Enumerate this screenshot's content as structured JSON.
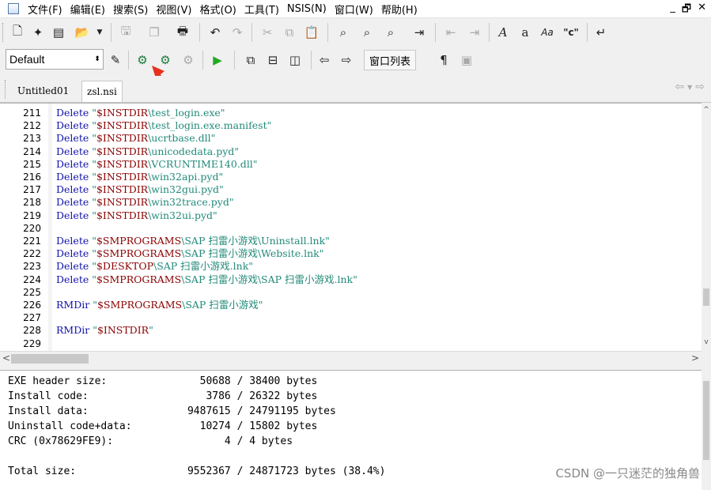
{
  "menu": [
    "文件(F)",
    "编辑(E)",
    "搜索(S)",
    "视图(V)",
    "格式(O)",
    "工具(T)",
    "NSIS(N)",
    "窗口(W)",
    "帮助(H)"
  ],
  "window_controls": [
    "_",
    "🗗",
    "✕"
  ],
  "toolbar2": {
    "style_value": "Default",
    "window_list_label": "窗口列表"
  },
  "tabs": [
    "Untitled01",
    "zsl.nsi"
  ],
  "editor_lines": [
    {
      "n": "211",
      "kw": "Delete",
      "var": "$INSTDIR",
      "rest": "\\test_login.exe\""
    },
    {
      "n": "212",
      "kw": "Delete",
      "var": "$INSTDIR",
      "rest": "\\test_login.exe.manifest\""
    },
    {
      "n": "213",
      "kw": "Delete",
      "var": "$INSTDIR",
      "rest": "\\ucrtbase.dll\""
    },
    {
      "n": "214",
      "kw": "Delete",
      "var": "$INSTDIR",
      "rest": "\\unicodedata.pyd\""
    },
    {
      "n": "215",
      "kw": "Delete",
      "var": "$INSTDIR",
      "rest": "\\VCRUNTIME140.dll\""
    },
    {
      "n": "216",
      "kw": "Delete",
      "var": "$INSTDIR",
      "rest": "\\win32api.pyd\""
    },
    {
      "n": "217",
      "kw": "Delete",
      "var": "$INSTDIR",
      "rest": "\\win32gui.pyd\""
    },
    {
      "n": "218",
      "kw": "Delete",
      "var": "$INSTDIR",
      "rest": "\\win32trace.pyd\""
    },
    {
      "n": "219",
      "kw": "Delete",
      "var": "$INSTDIR",
      "rest": "\\win32ui.pyd\""
    },
    {
      "n": "220",
      "kw": "",
      "var": "",
      "rest": ""
    },
    {
      "n": "221",
      "kw": "Delete",
      "var": "$SMPROGRAMS",
      "rest": "\\SAP 扫雷小游戏\\Uninstall.lnk\""
    },
    {
      "n": "222",
      "kw": "Delete",
      "var": "$SMPROGRAMS",
      "rest": "\\SAP 扫雷小游戏\\Website.lnk\""
    },
    {
      "n": "223",
      "kw": "Delete",
      "var": "$DESKTOP",
      "rest": "\\SAP 扫雷小游戏.lnk\""
    },
    {
      "n": "224",
      "kw": "Delete",
      "var": "$SMPROGRAMS",
      "rest": "\\SAP 扫雷小游戏\\SAP 扫雷小游戏.lnk\""
    },
    {
      "n": "225",
      "kw": "",
      "var": "",
      "rest": ""
    },
    {
      "n": "226",
      "kw": "RMDir",
      "var": "$SMPROGRAMS",
      "rest": "\\SAP 扫雷小游戏\""
    },
    {
      "n": "227",
      "kw": "",
      "var": "",
      "rest": ""
    },
    {
      "n": "228",
      "kw": "RMDir",
      "var": "$INSTDIR",
      "rest": "\""
    },
    {
      "n": "229",
      "kw": "",
      "var": "",
      "rest": ""
    }
  ],
  "output_lines": [
    "EXE header size:               50688 / 38400 bytes",
    "Install code:                   3786 / 26322 bytes",
    "Install data:                9487615 / 24791195 bytes",
    "Uninstall code+data:           10274 / 15802 bytes",
    "CRC (0x78629FE9):                  4 / 4 bytes",
    "",
    "Total size:                  9552367 / 24871723 bytes (38.4%)"
  ],
  "watermark": "CSDN @一只迷茫的独角兽",
  "colors": {
    "keyword": "#1010aa",
    "variable": "#8b0000",
    "string": "#228a7a",
    "arrow": "#e8301f"
  }
}
